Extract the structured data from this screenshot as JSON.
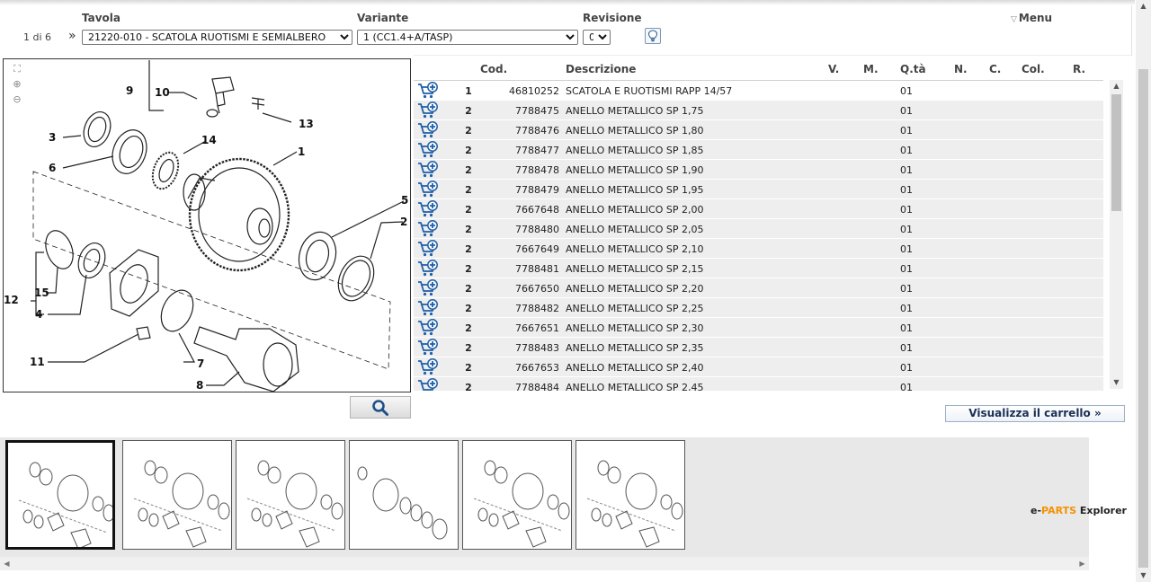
{
  "header": {
    "tavola_label": "Tavola",
    "variante_label": "Variante",
    "revisione_label": "Revisione",
    "menu_label": "Menu",
    "pager_text": "1 di 6",
    "pager_next": "»",
    "tavola_value": "21220-010 - SCATOLA RUOTISMI E SEMIALBERO",
    "variante_value": "1 (CC1.4+A/TASP)",
    "revisione_value": "0"
  },
  "drawing": {
    "callouts": [
      "9",
      "10",
      "13",
      "3",
      "14",
      "1",
      "6",
      "5",
      "2",
      "15",
      "12",
      "4",
      "11",
      "7",
      "8"
    ]
  },
  "table": {
    "headers": {
      "cod": "Cod.",
      "descrizione": "Descrizione",
      "v": "V.",
      "m": "M.",
      "qta": "Q.tà",
      "n": "N.",
      "c": "C.",
      "col": "Col.",
      "r": "R."
    },
    "rows": [
      {
        "ref": "1",
        "code": "46810252",
        "desc": "SCATOLA E RUOTISMI RAPP 14/57",
        "qty": "01"
      },
      {
        "ref": "2",
        "code": "7788475",
        "desc": "ANELLO METALLICO SP 1,75",
        "qty": "01"
      },
      {
        "ref": "2",
        "code": "7788476",
        "desc": "ANELLO METALLICO SP 1,80",
        "qty": "01"
      },
      {
        "ref": "2",
        "code": "7788477",
        "desc": "ANELLO METALLICO SP 1,85",
        "qty": "01"
      },
      {
        "ref": "2",
        "code": "7788478",
        "desc": "ANELLO METALLICO SP 1,90",
        "qty": "01"
      },
      {
        "ref": "2",
        "code": "7788479",
        "desc": "ANELLO METALLICO SP 1,95",
        "qty": "01"
      },
      {
        "ref": "2",
        "code": "7667648",
        "desc": "ANELLO METALLICO SP 2,00",
        "qty": "01"
      },
      {
        "ref": "2",
        "code": "7788480",
        "desc": "ANELLO METALLICO SP 2,05",
        "qty": "01"
      },
      {
        "ref": "2",
        "code": "7667649",
        "desc": "ANELLO METALLICO SP 2,10",
        "qty": "01"
      },
      {
        "ref": "2",
        "code": "7788481",
        "desc": "ANELLO METALLICO SP 2,15",
        "qty": "01"
      },
      {
        "ref": "2",
        "code": "7667650",
        "desc": "ANELLO METALLICO SP 2,20",
        "qty": "01"
      },
      {
        "ref": "2",
        "code": "7788482",
        "desc": "ANELLO METALLICO SP 2,25",
        "qty": "01"
      },
      {
        "ref": "2",
        "code": "7667651",
        "desc": "ANELLO METALLICO SP 2,30",
        "qty": "01"
      },
      {
        "ref": "2",
        "code": "7788483",
        "desc": "ANELLO METALLICO SP 2,35",
        "qty": "01"
      },
      {
        "ref": "2",
        "code": "7667653",
        "desc": "ANELLO METALLICO SP 2,40",
        "qty": "01"
      },
      {
        "ref": "2",
        "code": "7788484",
        "desc": "ANELLO METALLICO SP 2,45",
        "qty": "01"
      }
    ]
  },
  "actions": {
    "cart_link": "Visualizza il carrello »"
  },
  "brand": {
    "prefix": "e-",
    "parts": "PARTS",
    "suffix": " Explorer"
  },
  "icons": {
    "cart": "add-to-cart-icon",
    "search": "magnifier-icon",
    "hint": "lightbulb-icon"
  },
  "colors": {
    "row_alt": "#eeeeee",
    "cart_icon": "#1f5fa8",
    "brand_accent": "#f39200",
    "cart_link_text": "#1b2f55"
  }
}
